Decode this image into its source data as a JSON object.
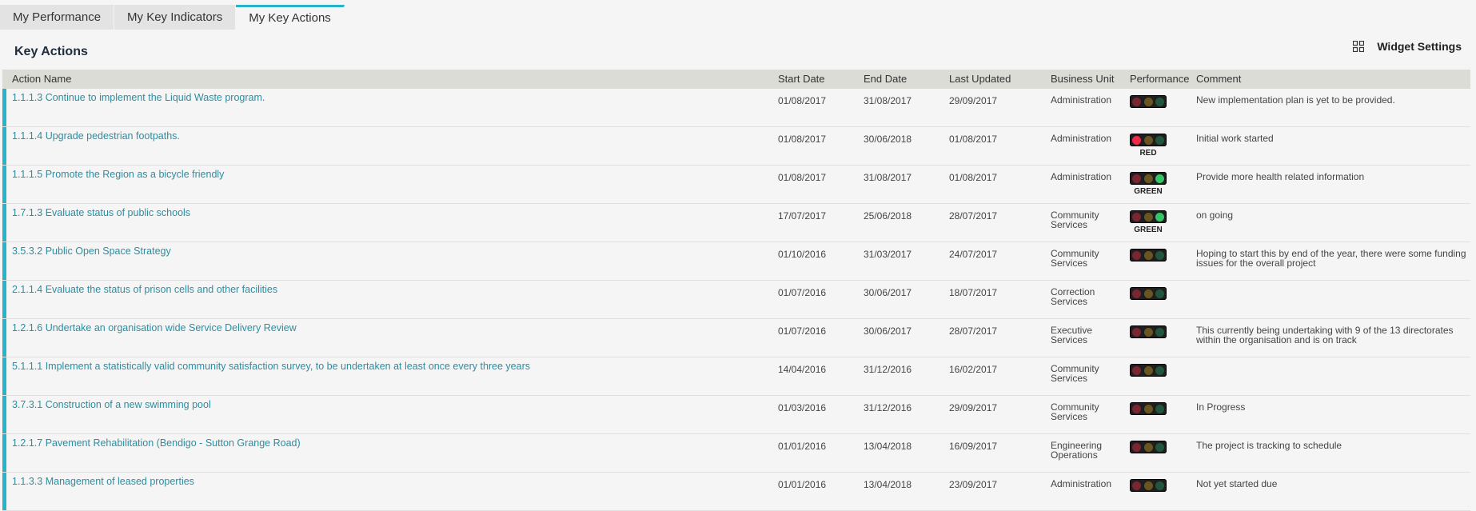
{
  "tabs": [
    {
      "label": "My Performance"
    },
    {
      "label": "My Key Indicators"
    },
    {
      "label": "My Key Actions"
    }
  ],
  "widget": {
    "title": "Key Actions",
    "settings_label": "Widget Settings"
  },
  "columns": {
    "name": "Action Name",
    "start": "Start Date",
    "end": "End Date",
    "updated": "Last Updated",
    "unit": "Business Unit",
    "performance": "Performance",
    "comment": "Comment"
  },
  "rows": [
    {
      "name": "1.1.1.3 Continue to implement the Liquid Waste program.",
      "start": "01/08/2017",
      "end": "31/08/2017",
      "updated": "29/09/2017",
      "unit": "Administration",
      "status": "",
      "comment": "New implementation plan is yet to be provided."
    },
    {
      "name": "1.1.1.4 Upgrade pedestrian footpaths.",
      "start": "01/08/2017",
      "end": "30/06/2018",
      "updated": "01/08/2017",
      "unit": "Administration",
      "status": "RED",
      "comment": "Initial work started"
    },
    {
      "name": "1.1.1.5 Promote the Region as a bicycle friendly",
      "start": "01/08/2017",
      "end": "31/08/2017",
      "updated": "01/08/2017",
      "unit": "Administration",
      "status": "GREEN",
      "comment": "Provide more health related information"
    },
    {
      "name": "1.7.1.3 Evaluate status of public schools",
      "start": "17/07/2017",
      "end": "25/06/2018",
      "updated": "28/07/2017",
      "unit": "Community Services",
      "status": "GREEN",
      "comment": "on going"
    },
    {
      "name": "3.5.3.2 Public Open Space Strategy",
      "start": "01/10/2016",
      "end": "31/03/2017",
      "updated": "24/07/2017",
      "unit": "Community Services",
      "status": "",
      "comment": "Hoping to start this by end of the year, there were some funding issues for the overall project"
    },
    {
      "name": "2.1.1.4 Evaluate the status of prison cells and other facilities",
      "start": "01/07/2016",
      "end": "30/06/2017",
      "updated": "18/07/2017",
      "unit": "Correction Services",
      "status": "",
      "comment": ""
    },
    {
      "name": "1.2.1.6 Undertake an organisation wide Service Delivery Review",
      "start": "01/07/2016",
      "end": "30/06/2017",
      "updated": "28/07/2017",
      "unit": "Executive Services",
      "status": "",
      "comment": "This currently being undertaking with 9 of the 13 directorates within the organisation and is on track"
    },
    {
      "name": "5.1.1.1 Implement a statistically valid community satisfaction survey, to be undertaken at least once every three years",
      "start": "14/04/2016",
      "end": "31/12/2016",
      "updated": "16/02/2017",
      "unit": "Community Services",
      "status": "",
      "comment": ""
    },
    {
      "name": "3.7.3.1 Construction of a new swimming pool",
      "start": "01/03/2016",
      "end": "31/12/2016",
      "updated": "29/09/2017",
      "unit": "Community Services",
      "status": "",
      "comment": "In Progress"
    },
    {
      "name": "1.2.1.7 Pavement Rehabilitation (Bendigo - Sutton Grange Road)",
      "start": "01/01/2016",
      "end": "13/04/2018",
      "updated": "16/09/2017",
      "unit": "Engineering Operations",
      "status": "",
      "comment": "The project is tracking to schedule"
    },
    {
      "name": "1.1.3.3 Management of leased properties",
      "start": "01/01/2016",
      "end": "13/04/2018",
      "updated": "23/09/2017",
      "unit": "Administration",
      "status": "",
      "comment": "Not yet started due"
    }
  ]
}
